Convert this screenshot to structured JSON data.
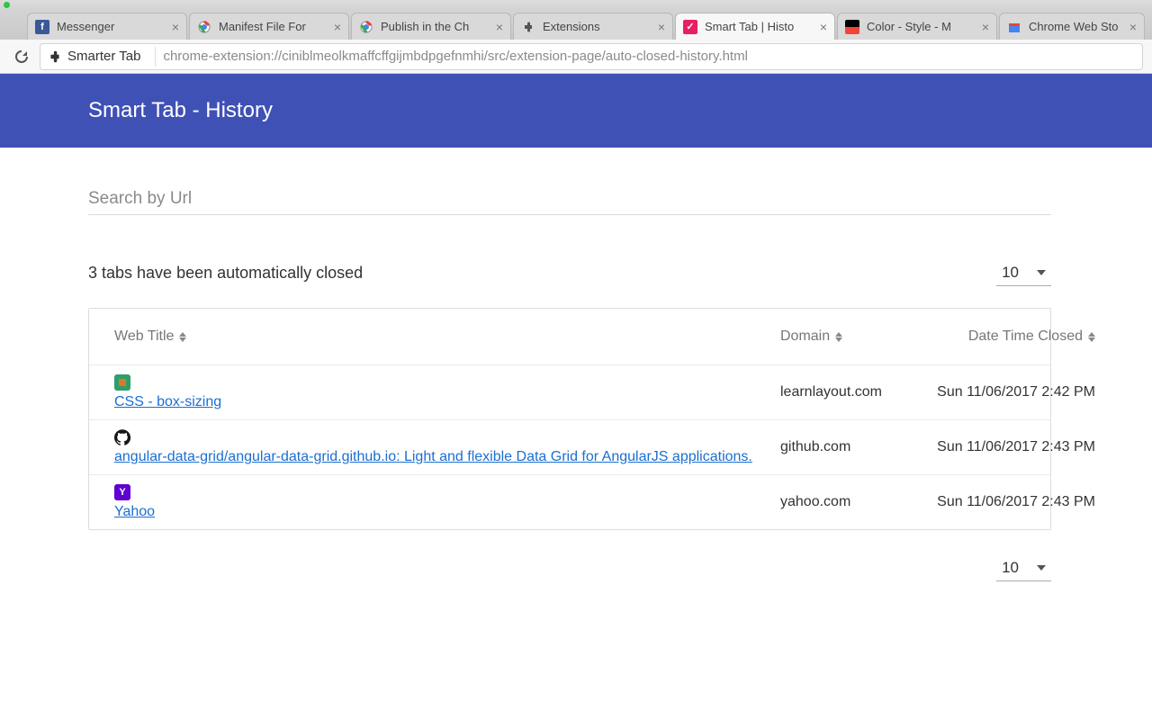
{
  "browser": {
    "tabs": [
      {
        "label": "Messenger"
      },
      {
        "label": "Manifest File For"
      },
      {
        "label": "Publish in the Ch"
      },
      {
        "label": "Extensions"
      },
      {
        "label": "Smart Tab | Histo"
      },
      {
        "label": "Color - Style - M"
      },
      {
        "label": "Chrome Web Sto"
      }
    ],
    "addr": {
      "ext_name": "Smarter Tab",
      "url": "chrome-extension://ciniblmeolkmaffcffgijmbdpgefnmhi/src/extension-page/auto-closed-history.html"
    }
  },
  "header": {
    "title": "Smart Tab - History"
  },
  "search": {
    "placeholder": "Search by Url"
  },
  "status": {
    "text": "3 tabs have been automatically closed"
  },
  "page_size": {
    "value": "10"
  },
  "table": {
    "columns": {
      "title": "Web Title",
      "domain": "Domain",
      "closed": "Date Time Closed"
    },
    "rows": [
      {
        "title": "CSS - box-sizing",
        "domain": "learnlayout.com",
        "closed": "Sun 11/06/2017 2:42 PM",
        "favicon_bg": "#2e9e6b",
        "favicon_text": ""
      },
      {
        "title": "angular-data-grid/angular-data-grid.github.io: Light and flexible Data Grid for AngularJS applications.",
        "domain": "github.com",
        "closed": "Sun 11/06/2017 2:43 PM",
        "favicon_bg": "#ffffff",
        "favicon_text": ""
      },
      {
        "title": "Yahoo",
        "domain": "yahoo.com",
        "closed": "Sun 11/06/2017 2:43 PM",
        "favicon_bg": "#5f01d1",
        "favicon_text": "Y"
      }
    ]
  }
}
